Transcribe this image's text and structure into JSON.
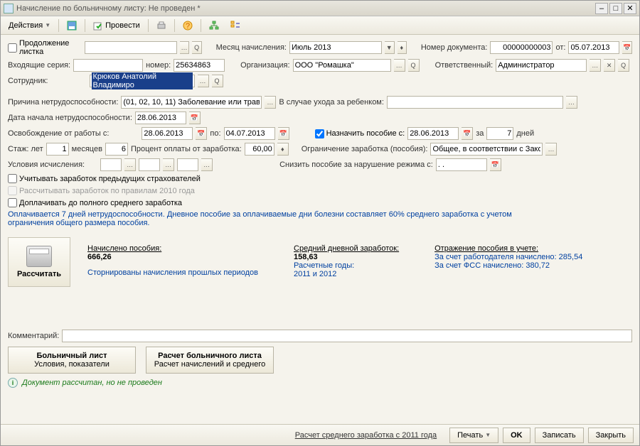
{
  "window_title": "Начисление по больничному листу: Не проведен *",
  "toolbar": {
    "actions": "Действия",
    "post": "Провести"
  },
  "header": {
    "cont_label": "Продолжение листка",
    "month_label": "Месяц начисления:",
    "month_value": "Июль 2013",
    "docnum_label": "Номер документа:",
    "docnum_value": "00000000003",
    "from_label": "от:",
    "from_value": "05.07.2013",
    "inseries_label": "Входящие серия:",
    "inseries_value": "",
    "num_label": "номер:",
    "num_value": "25634863",
    "org_label": "Организация:",
    "org_value": "ООО \"Ромашка\"",
    "resp_label": "Ответственный:",
    "resp_value": "Администратор",
    "employee_label": "Сотрудник:",
    "employee_value": "Крюков Анатолий Владимиро"
  },
  "form": {
    "reason_label": "Причина нетрудоспособности:",
    "reason_value": "(01, 02, 10, 11) Заболевание или травм",
    "childcare_label": "В случае ухода за ребенком:",
    "start_label": "Дата начала нетрудоспособности:",
    "start_value": "28.06.2013",
    "release_label": "Освобождение от работы с:",
    "release_from": "28.06.2013",
    "to_label": "по:",
    "release_to": "04.07.2013",
    "assign_label": "Назначить пособие с:",
    "assign_value": "28.06.2013",
    "days_for": "за",
    "days_value": "7",
    "days_unit": "дней",
    "stazh_label": "Стаж: лет",
    "stazh_years": "1",
    "stazh_months_label": "месяцев",
    "stazh_months": "6",
    "percent_label": "Процент оплаты от заработка:",
    "percent_value": "60,00",
    "limit_label": "Ограничение заработка (пособия):",
    "limit_value": "Общее, в соответствии с Зако",
    "calc_cond_label": "Условия исчисления:",
    "reduce_label": "Снизить пособие за нарушение режима с:",
    "reduce_value": ". .",
    "chk_prev": "Учитывать заработок предыдущих страхователей",
    "chk_2010": "Рассчитывать заработок по правилам 2010 года",
    "chk_full": "Доплачивать до полного среднего заработка",
    "info": "Оплачивается 7 дней нетрудоспособности. Дневное пособие за оплачиваемые дни болезни составляет 60% среднего заработка с учетом ограничения общего размера пособия."
  },
  "calc_button": "Рассчитать",
  "summary": {
    "col1_title": "Начислено пособия:",
    "col1_value": "666,26",
    "col1_link": "Сторнированы начисления прошлых периодов",
    "col2_title": "Средний дневной заработок:",
    "col2_value": "158,63",
    "col2_sub1": "Расчетные годы:",
    "col2_sub2": "2011 и 2012",
    "col3_title": "Отражение пособия в учете:",
    "col3_l1a": "За счет работодателя начислено: ",
    "col3_l1b": "285,54",
    "col3_l2a": "За счет ФСС начислено: ",
    "col3_l2b": "380,72"
  },
  "comment_label": "Комментарий:",
  "tabs": {
    "t1_title": "Больничный лист",
    "t1_sub": "Условия, показатели",
    "t2_title": "Расчет больничного листа",
    "t2_sub": "Расчет начислений и среднего"
  },
  "status_text": "Документ рассчитан, но не проведен",
  "footer": {
    "link": "Расчет среднего заработка с 2011 года",
    "print": "Печать",
    "ok": "OK",
    "save": "Записать",
    "close": "Закрыть"
  }
}
